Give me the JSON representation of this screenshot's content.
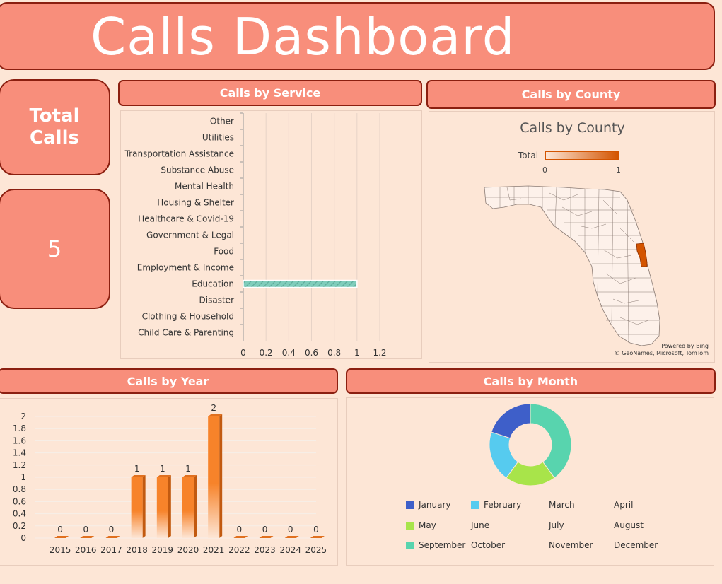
{
  "header": {
    "title": "Calls Dashboard"
  },
  "kpi": {
    "label": "Total Calls",
    "value": "5"
  },
  "sections": {
    "service": "Calls by Service",
    "county": "Calls by County",
    "year": "Calls by Year",
    "month": "Calls by Month"
  },
  "map": {
    "title": "Calls by County",
    "legend_label": "Total",
    "legend_min": "0",
    "legend_max": "1",
    "credit_line1": "Powered by Bing",
    "credit_line2": "© GeoNames, Microsoft, TomTom",
    "colors": {
      "low": "#fde6d6",
      "high": "#d35400"
    }
  },
  "chart_data": [
    {
      "type": "bar",
      "orientation": "horizontal",
      "title": "Calls by Service",
      "categories": [
        "Other",
        "Utilities",
        "Transportation Assistance",
        "Substance Abuse",
        "Mental Health",
        "Housing & Shelter",
        "Healthcare & Covid-19",
        "Government & Legal",
        "Food",
        "Employment & Income",
        "Education",
        "Disaster",
        "Clothing & Household",
        "Child Care & Parenting"
      ],
      "values": [
        0,
        0,
        0,
        0,
        0,
        0,
        0,
        0,
        0,
        0,
        1,
        0,
        0,
        0
      ],
      "xlim": [
        0,
        1.2
      ],
      "xticks": [
        "0",
        "0.2",
        "0.4",
        "0.6",
        "0.8",
        "1",
        "1.2"
      ],
      "color": "#7fcdbb",
      "grid": true
    },
    {
      "type": "bar",
      "title": "Calls by Year",
      "categories": [
        "2015",
        "2016",
        "2017",
        "2018",
        "2019",
        "2020",
        "2021",
        "2022",
        "2023",
        "2024",
        "2025"
      ],
      "values": [
        0,
        0,
        0,
        1,
        1,
        1,
        2,
        0,
        0,
        0,
        0
      ],
      "data_labels": [
        "0",
        "0",
        "0",
        "1",
        "1",
        "1",
        "2",
        "0",
        "0",
        "0",
        "0"
      ],
      "ylim": [
        0,
        2
      ],
      "yticks": [
        "0",
        "0.2",
        "0.4",
        "0.6",
        "0.8",
        "1",
        "1.2",
        "1.4",
        "1.6",
        "1.8",
        "2"
      ],
      "color": "#f7832a",
      "grid": true
    },
    {
      "type": "pie",
      "donut": true,
      "title": "Calls by Month",
      "labels": [
        "January",
        "February",
        "March",
        "April",
        "May",
        "June",
        "July",
        "August",
        "September",
        "October",
        "November",
        "December"
      ],
      "values": [
        1,
        1,
        0,
        0,
        1,
        0,
        0,
        0,
        2,
        0,
        0,
        0
      ],
      "colors": [
        "#3e5fc9",
        "#56cbef",
        "#9aa4a8",
        "#9aa4a8",
        "#a8e44a",
        "#9aa4a8",
        "#9aa4a8",
        "#9aa4a8",
        "#58d4ae",
        "#9aa4a8",
        "#9aa4a8",
        "#9aa4a8"
      ],
      "legend": "bottom"
    }
  ]
}
